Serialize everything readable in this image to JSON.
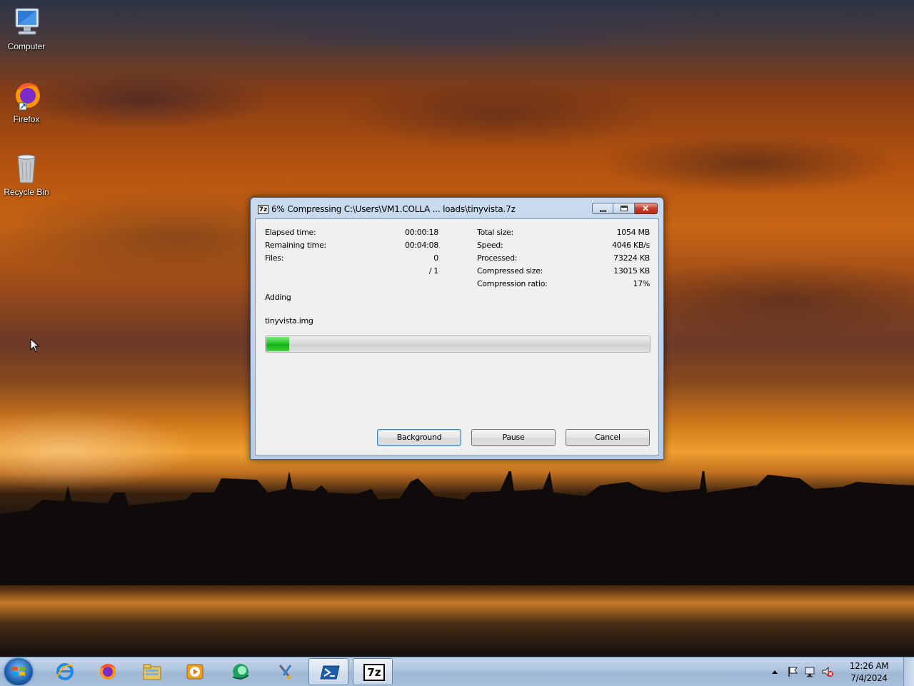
{
  "desktop": {
    "icons": [
      {
        "label": "Computer",
        "icon": "computer-icon"
      },
      {
        "label": "Firefox",
        "icon": "firefox-icon"
      },
      {
        "label": "Recycle Bin",
        "icon": "recycle-bin-icon"
      }
    ]
  },
  "dialog": {
    "app_icon_text": "7z",
    "title": "6% Compressing C:\\Users\\VM1.COLLA ... loads\\tinyvista.7z",
    "progress_fraction": 0.06,
    "left_stats": [
      {
        "label": "Elapsed time:",
        "value": "00:00:18"
      },
      {
        "label": "Remaining time:",
        "value": "00:04:08"
      },
      {
        "label": "Files:",
        "value": "0"
      },
      {
        "label": "",
        "value": "/ 1"
      }
    ],
    "right_stats": [
      {
        "label": "Total size:",
        "value": "1054 MB"
      },
      {
        "label": "Speed:",
        "value": "4046 KB/s"
      },
      {
        "label": "Processed:",
        "value": "73224 KB"
      },
      {
        "label": "Compressed size:",
        "value": "13015 KB"
      },
      {
        "label": "Compression ratio:",
        "value": "17%"
      }
    ],
    "status": "Adding",
    "current_file": "tinyvista.img",
    "buttons": {
      "background": "Background",
      "pause": "Pause",
      "cancel": "Cancel"
    }
  },
  "taskbar": {
    "items": [
      {
        "icon": "internet-explorer-icon",
        "active": false
      },
      {
        "icon": "firefox-icon",
        "active": false
      },
      {
        "icon": "file-explorer-icon",
        "active": false
      },
      {
        "icon": "media-player-icon",
        "active": false
      },
      {
        "icon": "green-orb-app-icon",
        "active": false
      },
      {
        "icon": "tools-icon",
        "active": false
      },
      {
        "icon": "powershell-icon",
        "active": true
      },
      {
        "icon": "7zip-icon",
        "active": true,
        "text": "7z"
      }
    ],
    "clock": {
      "time": "12:26 AM",
      "date": "7/4/2024"
    }
  },
  "colors": {
    "progress_green": "#1ec01e",
    "close_red": "#c8402c",
    "taskbar": "#aec4de"
  }
}
